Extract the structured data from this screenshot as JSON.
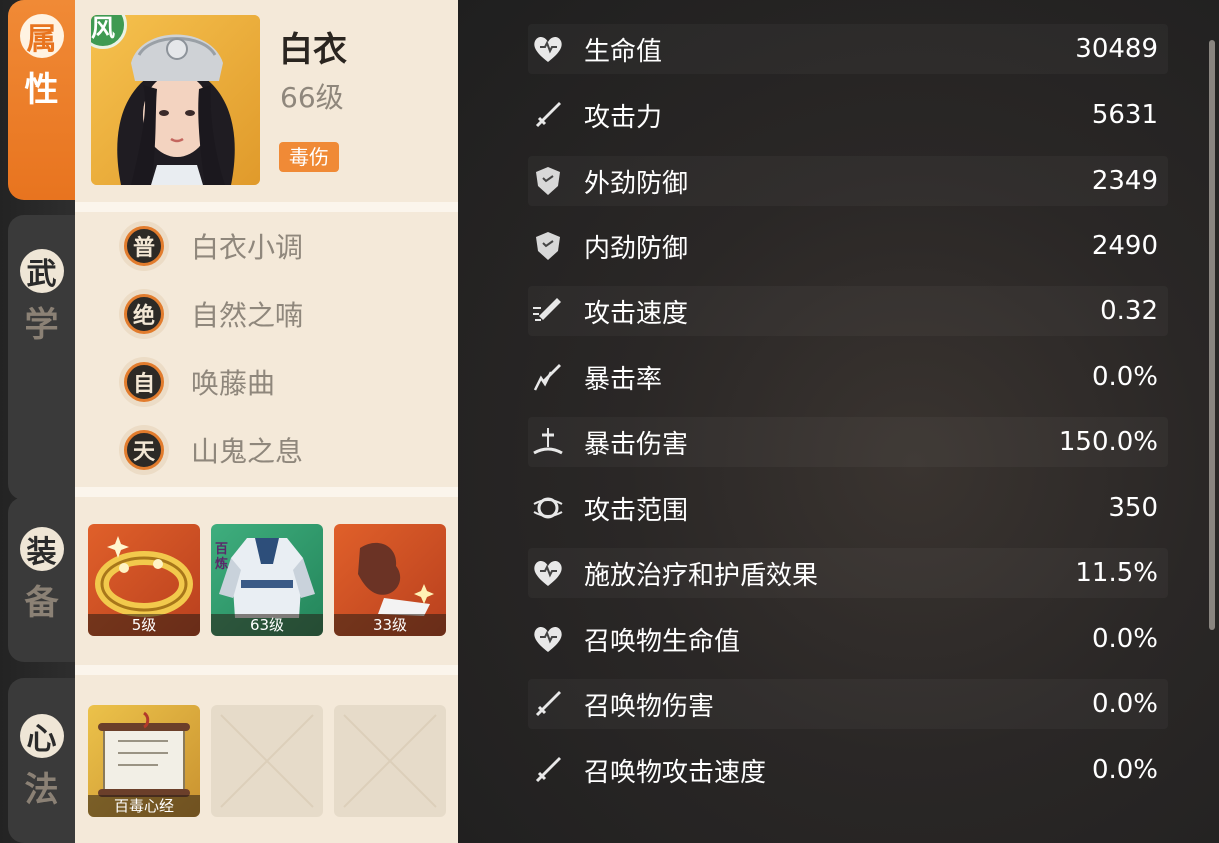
{
  "tabs": [
    {
      "c1": "属",
      "c2": "性",
      "active": true
    },
    {
      "c1": "武",
      "c2": "学",
      "active": false
    },
    {
      "c1": "装",
      "c2": "备",
      "active": false
    },
    {
      "c1": "心",
      "c2": "法",
      "active": false
    }
  ],
  "character": {
    "element": "风",
    "name": "白衣",
    "level": "66级",
    "tag": "毒伤"
  },
  "skills": [
    {
      "badge": "普",
      "name": "白衣小调"
    },
    {
      "badge": "绝",
      "name": "自然之喃"
    },
    {
      "badge": "自",
      "name": "唤藤曲"
    },
    {
      "badge": "天",
      "name": "山鬼之息"
    }
  ],
  "equipment": [
    {
      "level": "5级",
      "icon": "golden-bracelet-icon"
    },
    {
      "level": "63级",
      "icon": "armor-icon",
      "side_label": "百炼"
    },
    {
      "level": "33级",
      "icon": "boots-icon"
    }
  ],
  "manual": {
    "slots": [
      {
        "name": "百毒心经",
        "icon": "scroll-icon"
      },
      {
        "name": "",
        "icon": "empty-slot-icon"
      },
      {
        "name": "",
        "icon": "empty-slot-icon"
      }
    ],
    "scroll_text": "百毒心经"
  },
  "stats": [
    {
      "icon": "heart-icon",
      "name": "生命值",
      "value": "30489"
    },
    {
      "icon": "sword-icon",
      "name": "攻击力",
      "value": "5631"
    },
    {
      "icon": "shield-icon",
      "name": "外劲防御",
      "value": "2349"
    },
    {
      "icon": "shield-icon",
      "name": "内劲防御",
      "value": "2490"
    },
    {
      "icon": "attack-speed-icon",
      "name": "攻击速度",
      "value": "0.32"
    },
    {
      "icon": "crit-rate-icon",
      "name": "暴击率",
      "value": "0.0%"
    },
    {
      "icon": "crit-damage-icon",
      "name": "暴击伤害",
      "value": "150.0%"
    },
    {
      "icon": "range-icon",
      "name": "攻击范围",
      "value": "350"
    },
    {
      "icon": "heart-icon",
      "name": "施放治疗和护盾效果",
      "value": "11.5%"
    },
    {
      "icon": "heart-icon",
      "name": "召唤物生命值",
      "value": "0.0%"
    },
    {
      "icon": "sword-icon",
      "name": "召唤物伤害",
      "value": "0.0%"
    },
    {
      "icon": "sword-icon",
      "name": "召唤物攻击速度",
      "value": "0.0%"
    }
  ],
  "colors": {
    "accent": "#f08a36",
    "panel": "#f4e9d9",
    "element": "#3f9a52",
    "stats_bg": "#262626"
  }
}
